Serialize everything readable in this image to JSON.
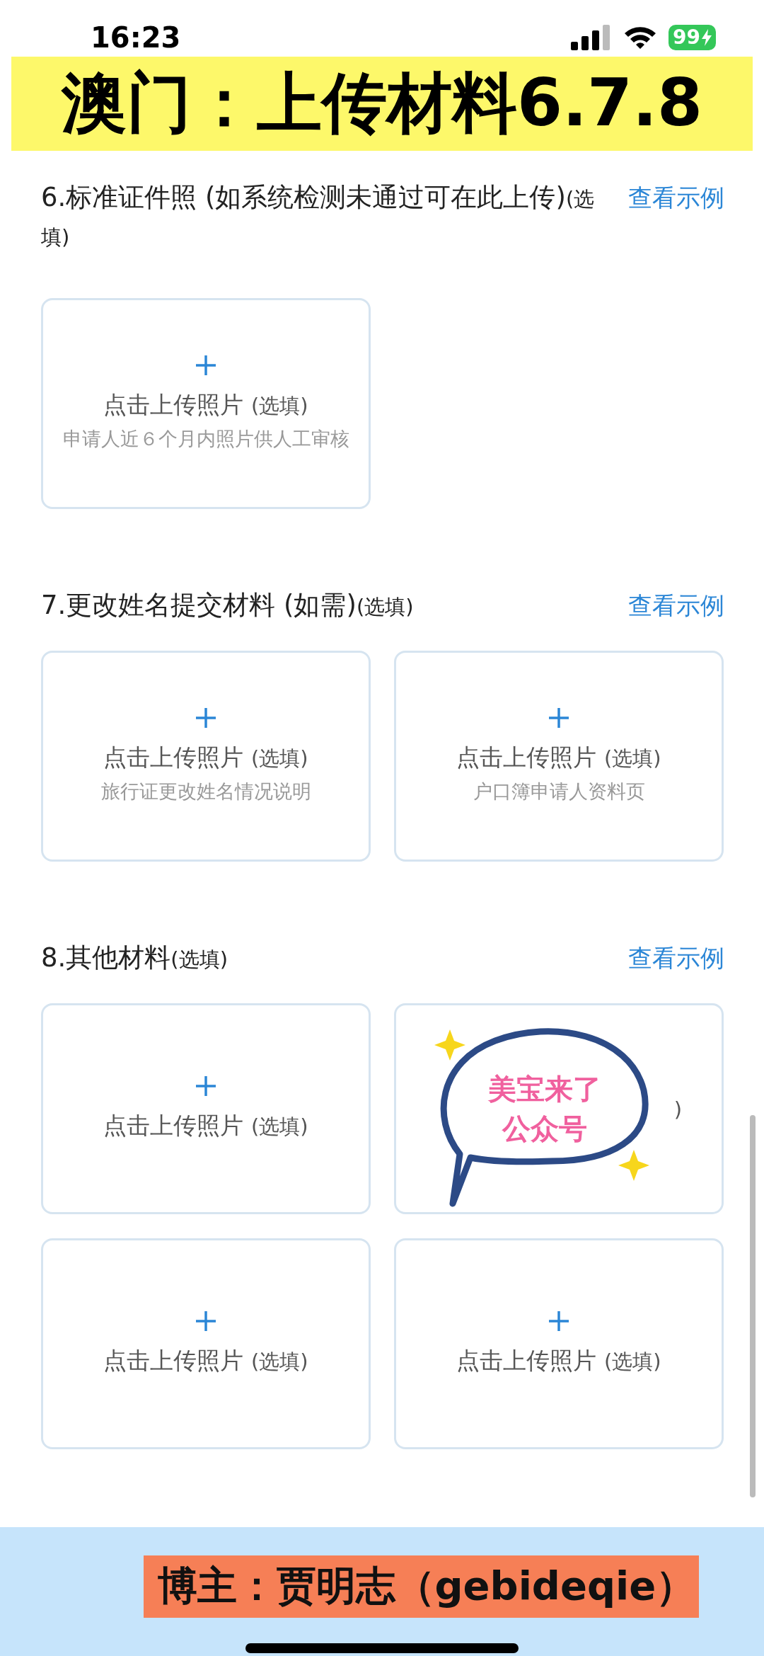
{
  "status_bar": {
    "time": "16:23",
    "battery": "99"
  },
  "banner": {
    "title": "澳门：上传材料6.7.8"
  },
  "sections": [
    {
      "title": "6.标准证件照 (如系统检测未通过可在此上传)",
      "optional": "(选填)",
      "link": "查看示例",
      "cards": [
        {
          "kind": "upload",
          "label": "点击上传照片",
          "optional": "(选填)",
          "hint": "申请人近６个月内照片供人工审核"
        }
      ]
    },
    {
      "title": "7.更改姓名提交材料 (如需)",
      "optional": "(选填)",
      "link": "查看示例",
      "cards": [
        {
          "kind": "upload",
          "label": "点击上传照片",
          "optional": "(选填)",
          "hint": "旅行证更改姓名情况说明"
        },
        {
          "kind": "upload",
          "label": "点击上传照片",
          "optional": "(选填)",
          "hint": "户口簿申请人资料页"
        }
      ]
    },
    {
      "title": "8.其他材料",
      "optional": "(选填)",
      "link": "查看示例",
      "cards": [
        {
          "kind": "upload",
          "label": "点击上传照片",
          "optional": "(选填)"
        },
        {
          "kind": "covered",
          "visible_text": ")",
          "sticker": [
            "美宝来了",
            "公众号"
          ]
        },
        {
          "kind": "upload",
          "label": "点击上传照片",
          "optional": "(选填)"
        },
        {
          "kind": "upload",
          "label": "点击上传照片",
          "optional": "(选填)"
        }
      ]
    }
  ],
  "footer": {
    "label": "博主：贾明志（gebideqie）"
  }
}
